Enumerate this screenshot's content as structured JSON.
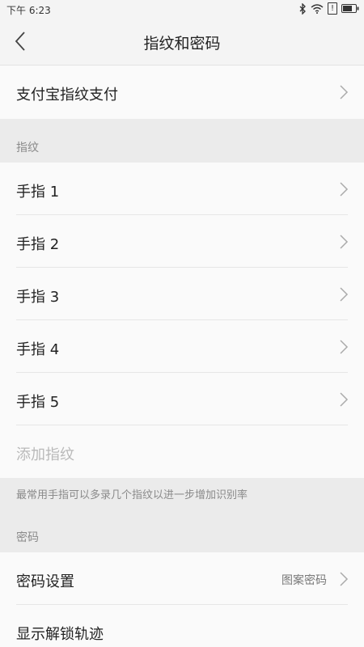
{
  "status_bar": {
    "time": "下午 6:23",
    "signal_text": "!"
  },
  "header": {
    "title": "指纹和密码"
  },
  "alipay": {
    "label": "支付宝指纹支付"
  },
  "fingerprint_section": {
    "title": "指纹"
  },
  "fingerprints": [
    {
      "label": "手指 1"
    },
    {
      "label": "手指 2"
    },
    {
      "label": "手指 3"
    },
    {
      "label": "手指 4"
    },
    {
      "label": "手指 5"
    }
  ],
  "add_fingerprint": {
    "label": "添加指纹"
  },
  "hint": {
    "text": "最常用手指可以多录几个指纹以进一步增加识别率"
  },
  "password_section": {
    "title": "密码"
  },
  "password_setting": {
    "label": "密码设置",
    "value": "图案密码"
  },
  "show_unlock_track": {
    "label": "显示解锁轨迹"
  }
}
